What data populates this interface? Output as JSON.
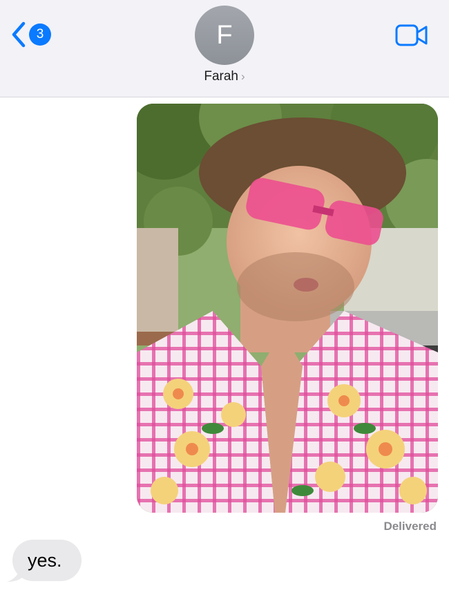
{
  "header": {
    "back_badge_count": "3",
    "contact_initial": "F",
    "contact_name": "Farah",
    "contact_chevron": "›",
    "back_icon": "chevron-left-icon",
    "video_icon": "video-camera-icon"
  },
  "messages": {
    "photo_alt": "Selfie of a man with pink sunglasses and a pink floral shirt",
    "status": "Delivered",
    "incoming_text": "yes."
  },
  "colors": {
    "accent": "#0a7aff",
    "header_bg": "#f2f2f7",
    "incoming_bubble": "#e9e9eb",
    "status_text": "#8a8a8e"
  }
}
